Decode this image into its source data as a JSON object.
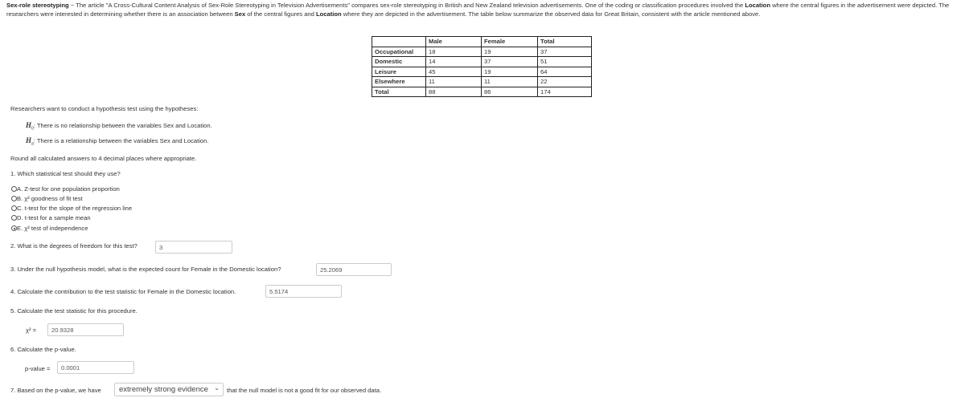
{
  "intro": {
    "title": "Sex-role stereotyping",
    "dash": " ~ ",
    "part1": "The article \"A Cross-Cultural Content Analysis of Sex-Role Stereotyping in Television Advertisements\" compares sex-role stereotyping in British and New Zealand television advertisements. One of the coding or classification procedures involved the ",
    "loc1": "Location",
    "part2": " where the central figures in the advertisement were depicted. The researchers were interested in determining whether there is an association between ",
    "sex": "Sex",
    "part3": " of the central figures and ",
    "loc2": "Location",
    "part4": " where they are depicted in the advertisement. The table below summarize the observed data for Great Britain, consistent with the article mentioned above."
  },
  "table": {
    "headers": [
      "",
      "Male",
      "Female",
      "Total"
    ],
    "rows": [
      [
        "Occupational",
        "18",
        "19",
        "37"
      ],
      [
        "Domestic",
        "14",
        "37",
        "51"
      ],
      [
        "Leisure",
        "45",
        "19",
        "64"
      ],
      [
        "Elsewhere",
        "11",
        "11",
        "22"
      ],
      [
        "Total",
        "88",
        "86",
        "174"
      ]
    ]
  },
  "hyp": {
    "intro": "Researchers want to conduct a hypothesis test using the hypotheses:",
    "h0_sym": "H",
    "h0_sub": "0",
    "h0": ": There is no relationship between the variables Sex and Location.",
    "ha_sym": "H",
    "ha_sub": "a",
    "ha": ": There is a relationship between the variables Sex and Location."
  },
  "round": "Round all calculated answers to 4 decimal places where appropriate.",
  "q1": {
    "text": "1. Which statistical test should they use?",
    "options": [
      "A. Z-test for one population proportion",
      "B. χ² goodness of fit test",
      "C. t-test for the slope of the regression line",
      "D. t-test for a sample mean",
      "E. χ² test of independence"
    ],
    "selected": "E"
  },
  "q2": {
    "text": "2. What is the degrees of freedom for this test?",
    "value": "3"
  },
  "q3": {
    "text": "3. Under the null hypothesis model, what is the expected count for Female in the Domestic location?",
    "value": "25.2069"
  },
  "q4": {
    "text": "4. Calculate the contribution to the test statistic for Female in the Domestic location.",
    "value": "5.5174"
  },
  "q5": {
    "text": "5. Calculate the test statistic for this procedure.",
    "label": "χ² =",
    "value": "20.9328"
  },
  "q6": {
    "text": "6. Calculate the p-value.",
    "label": "p-value =",
    "value": "0.0001"
  },
  "q7": {
    "before": "7. Based on the p-value, we have",
    "selected": "extremely strong evidence",
    "after": "that the null model is not a good fit for our observed data."
  }
}
